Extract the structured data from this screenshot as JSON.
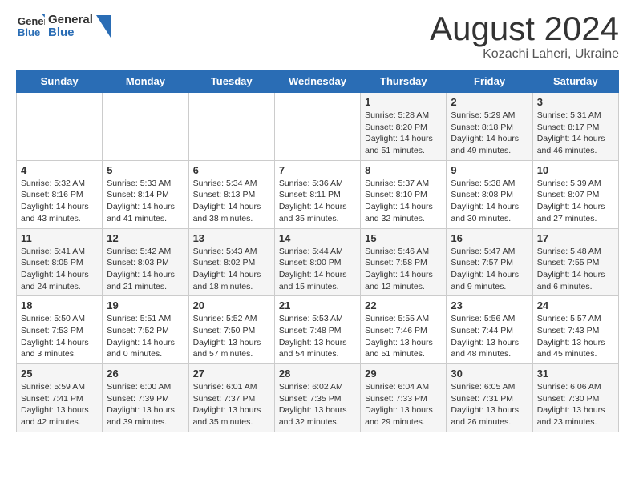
{
  "header": {
    "logo_general": "General",
    "logo_blue": "Blue",
    "month_title": "August 2024",
    "location": "Kozachi Laheri, Ukraine"
  },
  "calendar": {
    "days_of_week": [
      "Sunday",
      "Monday",
      "Tuesday",
      "Wednesday",
      "Thursday",
      "Friday",
      "Saturday"
    ],
    "weeks": [
      [
        {
          "day": "",
          "info": ""
        },
        {
          "day": "",
          "info": ""
        },
        {
          "day": "",
          "info": ""
        },
        {
          "day": "",
          "info": ""
        },
        {
          "day": "1",
          "info": "Sunrise: 5:28 AM\nSunset: 8:20 PM\nDaylight: 14 hours\nand 51 minutes."
        },
        {
          "day": "2",
          "info": "Sunrise: 5:29 AM\nSunset: 8:18 PM\nDaylight: 14 hours\nand 49 minutes."
        },
        {
          "day": "3",
          "info": "Sunrise: 5:31 AM\nSunset: 8:17 PM\nDaylight: 14 hours\nand 46 minutes."
        }
      ],
      [
        {
          "day": "4",
          "info": "Sunrise: 5:32 AM\nSunset: 8:16 PM\nDaylight: 14 hours\nand 43 minutes."
        },
        {
          "day": "5",
          "info": "Sunrise: 5:33 AM\nSunset: 8:14 PM\nDaylight: 14 hours\nand 41 minutes."
        },
        {
          "day": "6",
          "info": "Sunrise: 5:34 AM\nSunset: 8:13 PM\nDaylight: 14 hours\nand 38 minutes."
        },
        {
          "day": "7",
          "info": "Sunrise: 5:36 AM\nSunset: 8:11 PM\nDaylight: 14 hours\nand 35 minutes."
        },
        {
          "day": "8",
          "info": "Sunrise: 5:37 AM\nSunset: 8:10 PM\nDaylight: 14 hours\nand 32 minutes."
        },
        {
          "day": "9",
          "info": "Sunrise: 5:38 AM\nSunset: 8:08 PM\nDaylight: 14 hours\nand 30 minutes."
        },
        {
          "day": "10",
          "info": "Sunrise: 5:39 AM\nSunset: 8:07 PM\nDaylight: 14 hours\nand 27 minutes."
        }
      ],
      [
        {
          "day": "11",
          "info": "Sunrise: 5:41 AM\nSunset: 8:05 PM\nDaylight: 14 hours\nand 24 minutes."
        },
        {
          "day": "12",
          "info": "Sunrise: 5:42 AM\nSunset: 8:03 PM\nDaylight: 14 hours\nand 21 minutes."
        },
        {
          "day": "13",
          "info": "Sunrise: 5:43 AM\nSunset: 8:02 PM\nDaylight: 14 hours\nand 18 minutes."
        },
        {
          "day": "14",
          "info": "Sunrise: 5:44 AM\nSunset: 8:00 PM\nDaylight: 14 hours\nand 15 minutes."
        },
        {
          "day": "15",
          "info": "Sunrise: 5:46 AM\nSunset: 7:58 PM\nDaylight: 14 hours\nand 12 minutes."
        },
        {
          "day": "16",
          "info": "Sunrise: 5:47 AM\nSunset: 7:57 PM\nDaylight: 14 hours\nand 9 minutes."
        },
        {
          "day": "17",
          "info": "Sunrise: 5:48 AM\nSunset: 7:55 PM\nDaylight: 14 hours\nand 6 minutes."
        }
      ],
      [
        {
          "day": "18",
          "info": "Sunrise: 5:50 AM\nSunset: 7:53 PM\nDaylight: 14 hours\nand 3 minutes."
        },
        {
          "day": "19",
          "info": "Sunrise: 5:51 AM\nSunset: 7:52 PM\nDaylight: 14 hours\nand 0 minutes."
        },
        {
          "day": "20",
          "info": "Sunrise: 5:52 AM\nSunset: 7:50 PM\nDaylight: 13 hours\nand 57 minutes."
        },
        {
          "day": "21",
          "info": "Sunrise: 5:53 AM\nSunset: 7:48 PM\nDaylight: 13 hours\nand 54 minutes."
        },
        {
          "day": "22",
          "info": "Sunrise: 5:55 AM\nSunset: 7:46 PM\nDaylight: 13 hours\nand 51 minutes."
        },
        {
          "day": "23",
          "info": "Sunrise: 5:56 AM\nSunset: 7:44 PM\nDaylight: 13 hours\nand 48 minutes."
        },
        {
          "day": "24",
          "info": "Sunrise: 5:57 AM\nSunset: 7:43 PM\nDaylight: 13 hours\nand 45 minutes."
        }
      ],
      [
        {
          "day": "25",
          "info": "Sunrise: 5:59 AM\nSunset: 7:41 PM\nDaylight: 13 hours\nand 42 minutes."
        },
        {
          "day": "26",
          "info": "Sunrise: 6:00 AM\nSunset: 7:39 PM\nDaylight: 13 hours\nand 39 minutes."
        },
        {
          "day": "27",
          "info": "Sunrise: 6:01 AM\nSunset: 7:37 PM\nDaylight: 13 hours\nand 35 minutes."
        },
        {
          "day": "28",
          "info": "Sunrise: 6:02 AM\nSunset: 7:35 PM\nDaylight: 13 hours\nand 32 minutes."
        },
        {
          "day": "29",
          "info": "Sunrise: 6:04 AM\nSunset: 7:33 PM\nDaylight: 13 hours\nand 29 minutes."
        },
        {
          "day": "30",
          "info": "Sunrise: 6:05 AM\nSunset: 7:31 PM\nDaylight: 13 hours\nand 26 minutes."
        },
        {
          "day": "31",
          "info": "Sunrise: 6:06 AM\nSunset: 7:30 PM\nDaylight: 13 hours\nand 23 minutes."
        }
      ]
    ]
  }
}
